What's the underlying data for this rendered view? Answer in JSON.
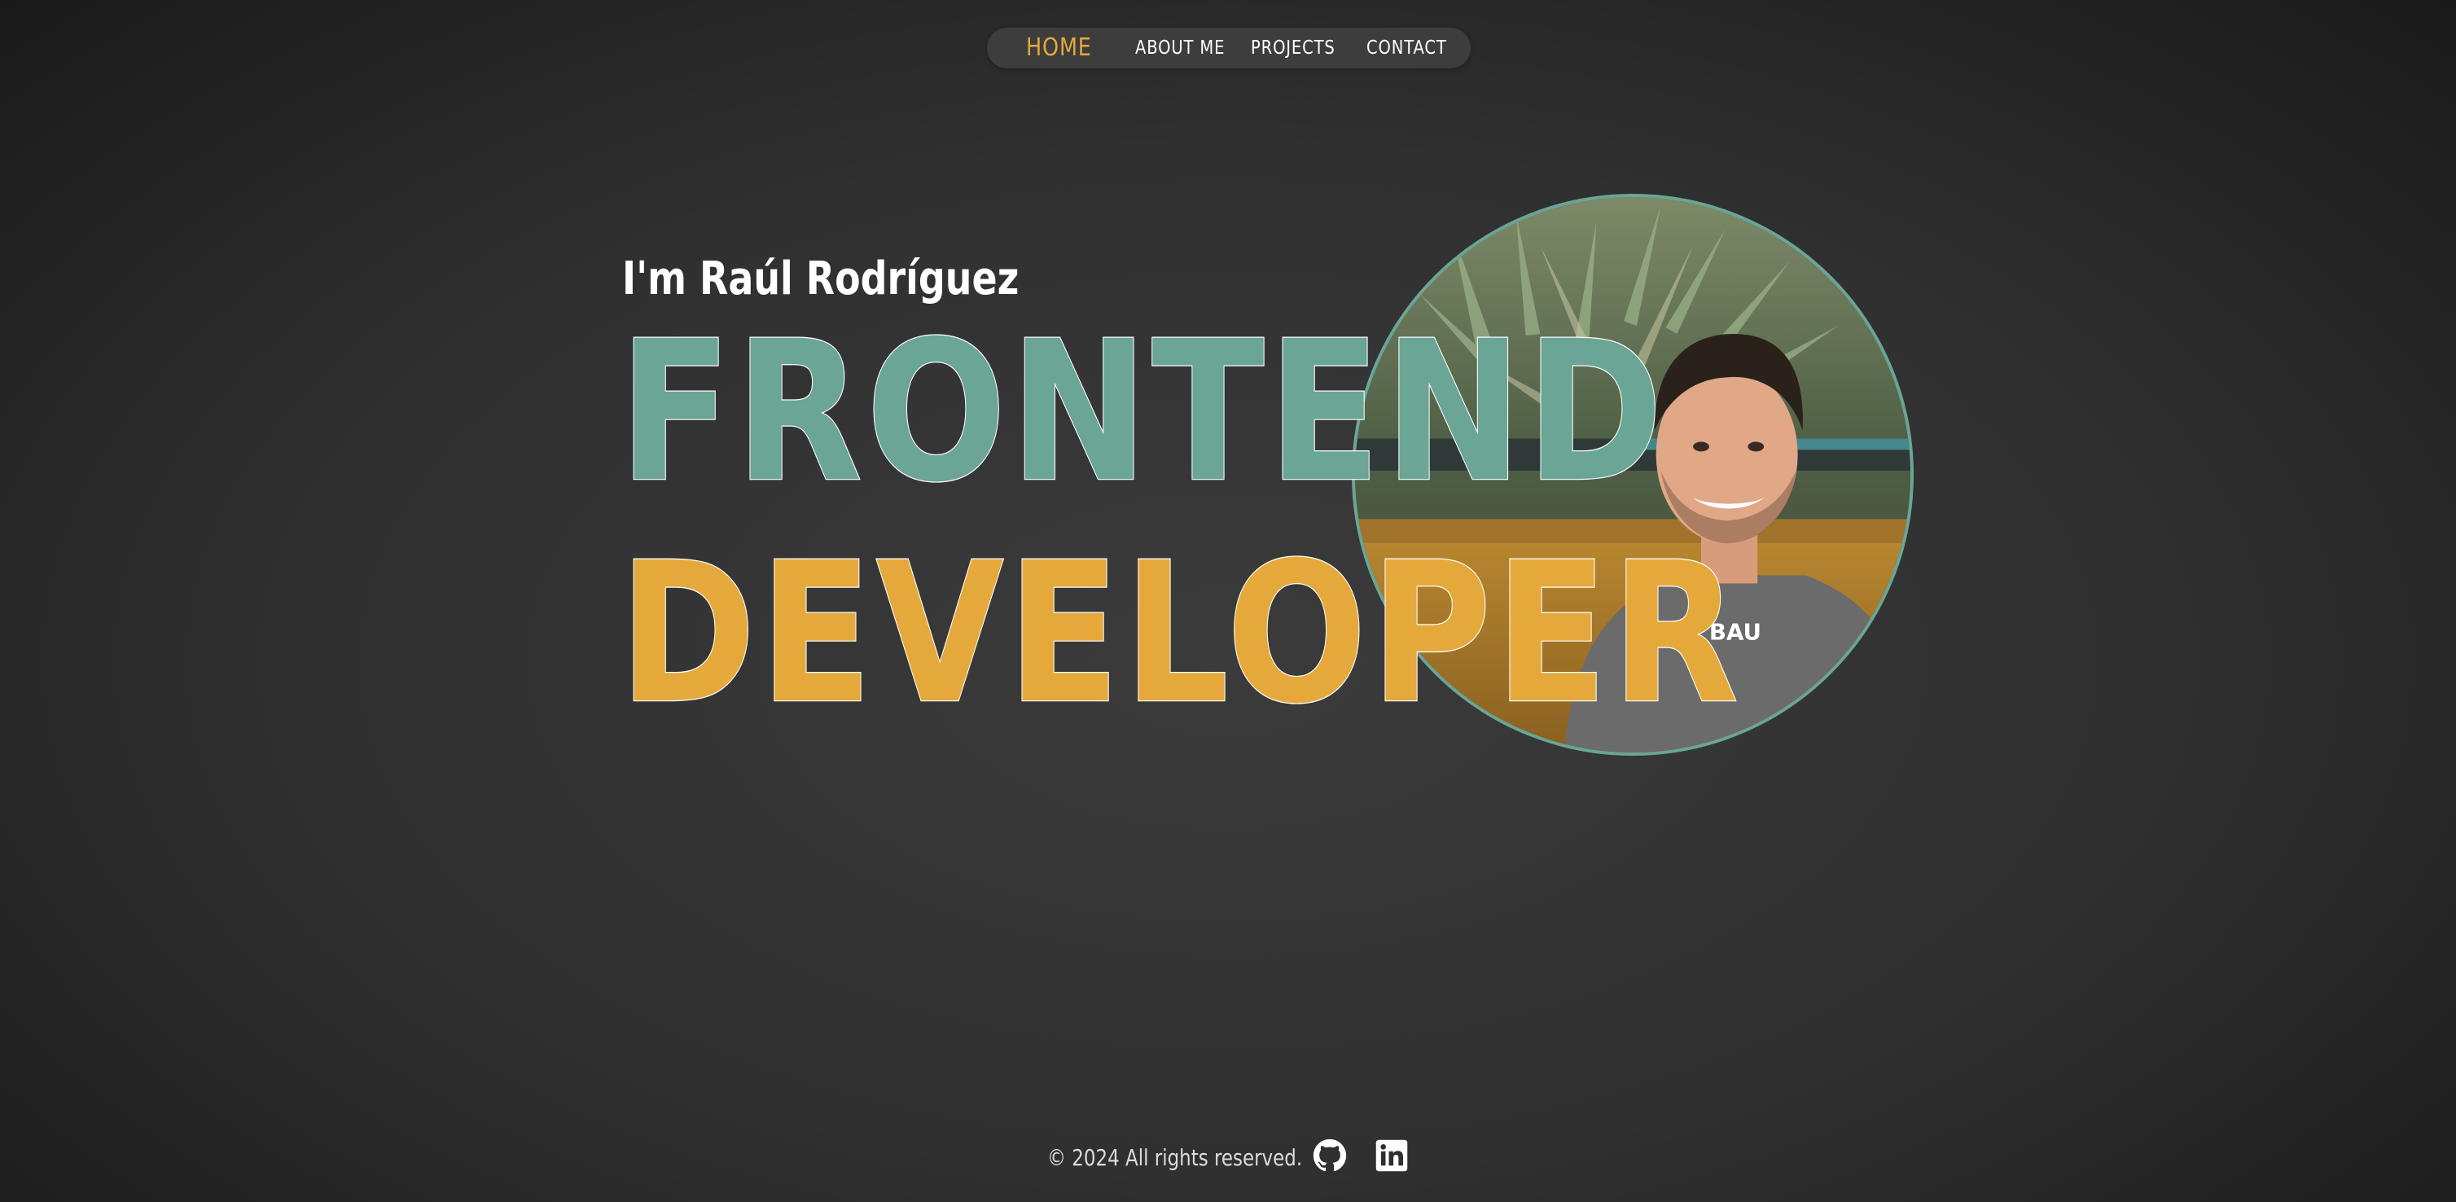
{
  "nav": {
    "items": [
      {
        "label": "HOME",
        "active": true
      },
      {
        "label": "ABOUT ME",
        "active": false
      },
      {
        "label": "PROJECTS",
        "active": false
      },
      {
        "label": "CONTACT",
        "active": false
      }
    ]
  },
  "hero": {
    "intro": "I'm Raúl Rodríguez",
    "line1": "FRONTEND",
    "line2": "DEVELOPER",
    "shirt_logo": "BAU"
  },
  "footer": {
    "copyright": "© 2024 All rights reserved.",
    "social": [
      {
        "icon": "github-icon"
      },
      {
        "icon": "linkedin-icon"
      }
    ]
  },
  "colors": {
    "accent_orange": "#e5a93b",
    "accent_green": "#6aa596",
    "text_white": "#ffffff",
    "nav_bg": "#3d3d3d",
    "page_bg": "#303030"
  }
}
